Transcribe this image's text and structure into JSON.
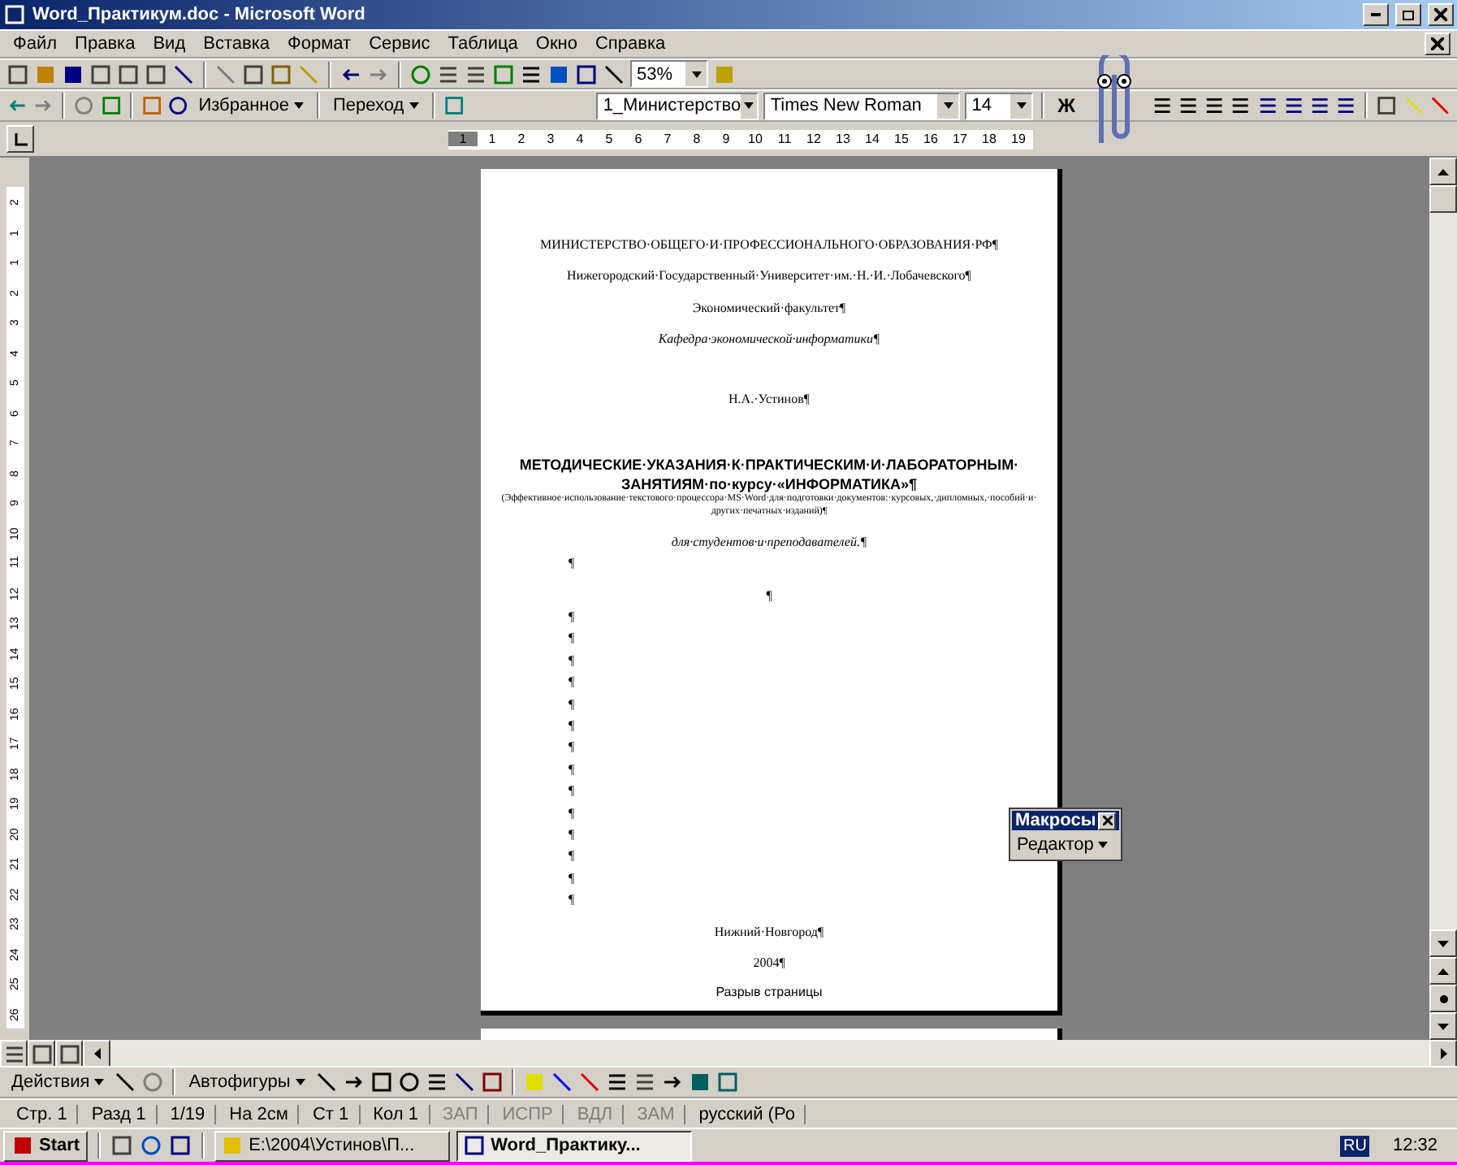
{
  "window": {
    "title": "Word_Практикум.doc - Microsoft Word"
  },
  "menu": [
    "Файл",
    "Правка",
    "Вид",
    "Вставка",
    "Формат",
    "Сервис",
    "Таблица",
    "Окно",
    "Справка"
  ],
  "standard_toolbar": {
    "zoom": "53%"
  },
  "web_toolbar": {
    "favorites": "Избранное",
    "go": "Переход"
  },
  "formatting_toolbar": {
    "style": "1_Министерство",
    "font": "Times New Roman",
    "size": "14",
    "bold": "Ж"
  },
  "ruler": {
    "labels": [
      "1",
      "1",
      "2",
      "3",
      "4",
      "5",
      "6",
      "7",
      "8",
      "9",
      "10",
      "11",
      "12",
      "13",
      "14",
      "15",
      "16",
      "17",
      "18",
      "19"
    ]
  },
  "vertical_ruler": {
    "labels": [
      "2",
      "1",
      "1",
      "2",
      "3",
      "4",
      "5",
      "6",
      "7",
      "8",
      "9",
      "10",
      "11",
      "12",
      "13",
      "14",
      "15",
      "16",
      "17",
      "18",
      "19",
      "20",
      "21",
      "22",
      "23",
      "24",
      "25",
      "26"
    ]
  },
  "page": {
    "paragraphs": [
      {
        "kind": "normal",
        "text": "МИНИСТЕРСТВО·ОБЩЕГО·И·ПРОФЕССИОНАЛЬНОГО·ОБРАЗОВАНИЯ·РФ¶"
      },
      {
        "kind": "normal",
        "text": "Нижегородский·Государственный·Университет·им.·Н.·И.·Лобачевского¶"
      },
      {
        "kind": "normal",
        "text": "Экономический·факультет¶"
      },
      {
        "kind": "italic",
        "text": "Кафедра·экономической·информатики¶"
      },
      {
        "kind": "gap",
        "text": "Н.А.·Устинов¶"
      },
      {
        "kind": "title",
        "text": "МЕТОДИЧЕСКИЕ·УКАЗАНИЯ·К·ПРАКТИЧЕСКИМ·И·ЛАБОРАТОРНЫМ·ЗАНЯТИЯМ·по·курсу·«ИНФОРМАТИКА»¶"
      },
      {
        "kind": "small",
        "text": "(Эффективное·использование·текстового·процессора·MS·Word·для·подготовки·документов:·курсовых,·дипломных,·пособий·и·других·печатных·изданий)¶"
      },
      {
        "kind": "italic",
        "text": "для·студентов·и·преподавателей.¶"
      },
      {
        "kind": "mark",
        "text": "¶"
      },
      {
        "kind": "normal",
        "text": "¶"
      },
      {
        "kind": "mark",
        "text": "¶"
      },
      {
        "kind": "mark",
        "text": "¶"
      },
      {
        "kind": "mark",
        "text": "¶"
      },
      {
        "kind": "mark",
        "text": "¶"
      },
      {
        "kind": "mark",
        "text": "¶"
      },
      {
        "kind": "mark",
        "text": "¶"
      },
      {
        "kind": "mark",
        "text": "¶"
      },
      {
        "kind": "mark",
        "text": "¶"
      },
      {
        "kind": "mark",
        "text": "¶"
      },
      {
        "kind": "mark",
        "text": "¶"
      },
      {
        "kind": "mark",
        "text": "¶"
      },
      {
        "kind": "mark",
        "text": "¶"
      },
      {
        "kind": "mark",
        "text": "¶"
      },
      {
        "kind": "mark",
        "text": "¶"
      },
      {
        "kind": "normal",
        "text": "Нижний·Новгород¶"
      },
      {
        "kind": "normal",
        "text": "2004¶"
      },
      {
        "kind": "break",
        "text": "Разрыв страницы"
      }
    ]
  },
  "macros_toolbar": {
    "title": "Макросы",
    "button": "Редактор"
  },
  "drawing_toolbar": {
    "actions": "Действия",
    "autoshapes": "Автофигуры"
  },
  "status_bar": {
    "cells": [
      {
        "text": "Стр. 1",
        "kind": "text"
      },
      {
        "text": "Разд 1",
        "kind": "text"
      },
      {
        "text": "1/19",
        "kind": "text"
      },
      {
        "text": "На 2см",
        "kind": "text"
      },
      {
        "text": "Ст 1",
        "kind": "text"
      },
      {
        "text": "Кол 1",
        "kind": "text"
      },
      {
        "text": "ЗАП",
        "kind": "mode"
      },
      {
        "text": "ИСПР",
        "kind": "mode"
      },
      {
        "text": "ВДЛ",
        "kind": "mode"
      },
      {
        "text": "ЗАМ",
        "kind": "mode"
      },
      {
        "text": "русский (Ро",
        "kind": "text"
      }
    ]
  },
  "taskbar": {
    "start": "Start",
    "tasks": [
      {
        "label": "E:\\2004\\Устинов\\П...",
        "selected": false
      },
      {
        "label": "Word_Практику...",
        "selected": true
      }
    ],
    "language": "RU",
    "clock": "12:32"
  }
}
